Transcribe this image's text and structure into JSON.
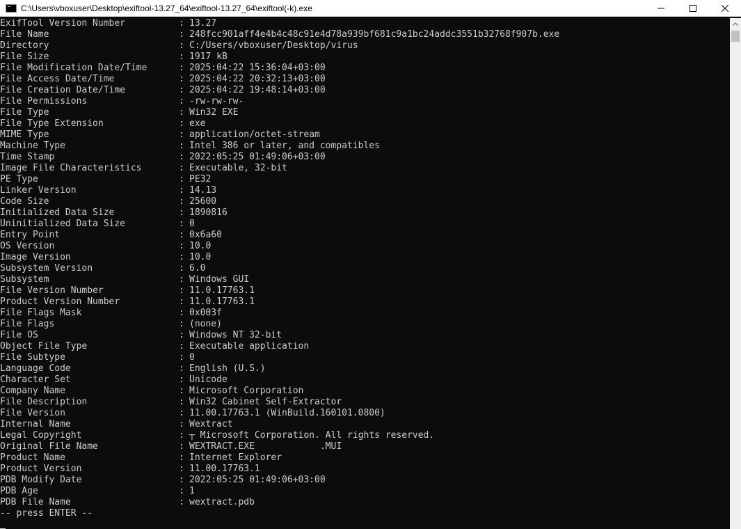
{
  "window": {
    "title": "C:\\Users\\vboxuser\\Desktop\\exiftool-13.27_64\\exiftool-13.27_64\\exiftool(-k).exe",
    "icons": {
      "app": "console-icon",
      "minimize": "minimize-icon",
      "maximize": "maximize-icon",
      "close": "close-icon"
    }
  },
  "terminal": {
    "separator": ":",
    "rows": [
      {
        "tag": "ExifTool Version Number",
        "value": "13.27"
      },
      {
        "tag": "File Name",
        "value": "248fcc901aff4e4b4c48c91e4d78a939bf681c9a1bc24addc3551b32768f907b.exe"
      },
      {
        "tag": "Directory",
        "value": "C:/Users/vboxuser/Desktop/virus"
      },
      {
        "tag": "File Size",
        "value": "1917 kB"
      },
      {
        "tag": "File Modification Date/Time",
        "value": "2025:04:22 15:36:04+03:00"
      },
      {
        "tag": "File Access Date/Time",
        "value": "2025:04:22 20:32:13+03:00"
      },
      {
        "tag": "File Creation Date/Time",
        "value": "2025:04:22 19:48:14+03:00"
      },
      {
        "tag": "File Permissions",
        "value": "-rw-rw-rw-"
      },
      {
        "tag": "File Type",
        "value": "Win32 EXE"
      },
      {
        "tag": "File Type Extension",
        "value": "exe"
      },
      {
        "tag": "MIME Type",
        "value": "application/octet-stream"
      },
      {
        "tag": "Machine Type",
        "value": "Intel 386 or later, and compatibles"
      },
      {
        "tag": "Time Stamp",
        "value": "2022:05:25 01:49:06+03:00"
      },
      {
        "tag": "Image File Characteristics",
        "value": "Executable, 32-bit"
      },
      {
        "tag": "PE Type",
        "value": "PE32"
      },
      {
        "tag": "Linker Version",
        "value": "14.13"
      },
      {
        "tag": "Code Size",
        "value": "25600"
      },
      {
        "tag": "Initialized Data Size",
        "value": "1890816"
      },
      {
        "tag": "Uninitialized Data Size",
        "value": "0"
      },
      {
        "tag": "Entry Point",
        "value": "0x6a60"
      },
      {
        "tag": "OS Version",
        "value": "10.0"
      },
      {
        "tag": "Image Version",
        "value": "10.0"
      },
      {
        "tag": "Subsystem Version",
        "value": "6.0"
      },
      {
        "tag": "Subsystem",
        "value": "Windows GUI"
      },
      {
        "tag": "File Version Number",
        "value": "11.0.17763.1"
      },
      {
        "tag": "Product Version Number",
        "value": "11.0.17763.1"
      },
      {
        "tag": "File Flags Mask",
        "value": "0x003f"
      },
      {
        "tag": "File Flags",
        "value": "(none)"
      },
      {
        "tag": "File OS",
        "value": "Windows NT 32-bit"
      },
      {
        "tag": "Object File Type",
        "value": "Executable application"
      },
      {
        "tag": "File Subtype",
        "value": "0"
      },
      {
        "tag": "Language Code",
        "value": "English (U.S.)"
      },
      {
        "tag": "Character Set",
        "value": "Unicode"
      },
      {
        "tag": "Company Name",
        "value": "Microsoft Corporation"
      },
      {
        "tag": "File Description",
        "value": "Win32 Cabinet Self-Extractor"
      },
      {
        "tag": "File Version",
        "value": "11.00.17763.1 (WinBuild.160101.0800)"
      },
      {
        "tag": "Internal Name",
        "value": "Wextract"
      },
      {
        "tag": "Legal Copyright",
        "value": "┬ Microsoft Corporation. All rights reserved."
      },
      {
        "tag": "Original File Name",
        "value": "WEXTRACT.EXE            .MUI"
      },
      {
        "tag": "Product Name",
        "value": "Internet Explorer"
      },
      {
        "tag": "Product Version",
        "value": "11.00.17763.1"
      },
      {
        "tag": "PDB Modify Date",
        "value": "2022:05:25 01:49:06+03:00"
      },
      {
        "tag": "PDB Age",
        "value": "1"
      },
      {
        "tag": "PDB File Name",
        "value": "wextract.pdb"
      }
    ],
    "prompt": "-- press ENTER --"
  },
  "colors": {
    "background": "#0c0c0c",
    "foreground": "#cccccc",
    "titlebar": "#ffffff"
  }
}
